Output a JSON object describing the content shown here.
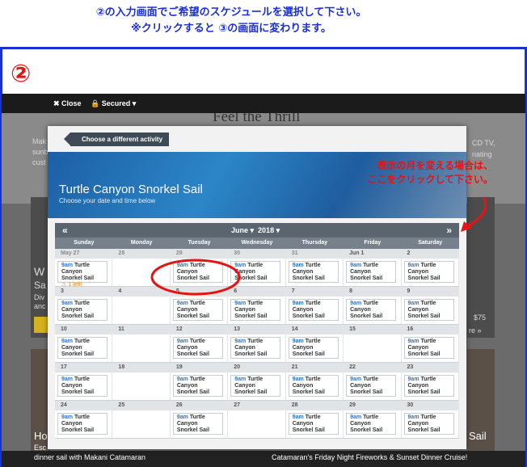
{
  "instructions": {
    "line1": "②の入力画面でご希望のスケジュールを選択して下さい。",
    "line2": "※クリックすると ③の画面に変わります。"
  },
  "step_number": "②",
  "topbar": {
    "close_label": "✖ Close",
    "secured_label": "🔒 Secured ▾"
  },
  "background": {
    "title": "Feel the Thrill",
    "left_snippets": [
      "Mak",
      "sunb",
      "cust"
    ],
    "right_snippets": [
      "CD TV,",
      "nating"
    ],
    "card_left": [
      "W",
      "Sa",
      "Div",
      "anc"
    ],
    "card_right": [
      "$75",
      "re »"
    ],
    "bottom_left_title": "Ho",
    "bottom_left_sub1": "Esc",
    "bottom_left_sub2": "dinner sail with Makani Catamaran",
    "bottom_right_title": "Sail",
    "bottom_right_sub": "Catamaran's Friday Night Fireworks & Sunset Dinner Cruise!"
  },
  "modal": {
    "back_label": "Choose a different activity",
    "title": "Turtle Canyon Snorkel Sail",
    "subtitle": "Choose your date and time below"
  },
  "calendar": {
    "prev_icon": "«",
    "next_icon": "»",
    "month": "June",
    "year": "2018",
    "weekdays": [
      "Sunday",
      "Monday",
      "Tuesday",
      "Wednesday",
      "Thursday",
      "Friday",
      "Saturday"
    ],
    "weeks": [
      [
        {
          "d": "May 27",
          "dim": true,
          "time": "9am",
          "name": "Turtle Canyon Snorkel Sail",
          "left": "⚠ 1 left!"
        },
        {
          "d": "28",
          "dim": true
        },
        {
          "d": "29",
          "dim": true,
          "time": "9am",
          "name": "Turtle Canyon Snorkel Sail"
        },
        {
          "d": "30",
          "dim": true,
          "time": "9am",
          "name": "Turtle Canyon Snorkel Sail"
        },
        {
          "d": "31",
          "dim": true,
          "time": "9am",
          "name": "Turtle Canyon Snorkel Sail"
        },
        {
          "d": "Jun 1",
          "time": "9am",
          "name": "Turtle Canyon Snorkel Sail"
        },
        {
          "d": "2",
          "time": "9am",
          "name": "Turtle Canyon Snorkel Sail"
        }
      ],
      [
        {
          "d": "3",
          "time": "9am",
          "name": "Turtle Canyon Snorkel Sail"
        },
        {
          "d": "4"
        },
        {
          "d": "5",
          "time": "9am",
          "name": "Turtle Canyon Snorkel Sail"
        },
        {
          "d": "6",
          "time": "9am",
          "name": "Turtle Canyon Snorkel Sail"
        },
        {
          "d": "7",
          "time": "9am",
          "name": "Turtle Canyon Snorkel Sail"
        },
        {
          "d": "8",
          "time": "9am",
          "name": "Turtle Canyon Snorkel Sail"
        },
        {
          "d": "9",
          "time": "9am",
          "name": "Turtle Canyon Snorkel Sail"
        }
      ],
      [
        {
          "d": "10",
          "time": "9am",
          "name": "Turtle Canyon Snorkel Sail"
        },
        {
          "d": "11"
        },
        {
          "d": "12",
          "time": "9am",
          "name": "Turtle Canyon Snorkel Sail"
        },
        {
          "d": "13",
          "time": "9am",
          "name": "Turtle Canyon Snorkel Sail"
        },
        {
          "d": "14",
          "time": "9am",
          "name": "Turtle Canyon Snorkel Sail"
        },
        {
          "d": "15"
        },
        {
          "d": "16",
          "time": "9am",
          "name": "Turtle Canyon Snorkel Sail"
        }
      ],
      [
        {
          "d": "17",
          "time": "9am",
          "name": "Turtle Canyon Snorkel Sail"
        },
        {
          "d": "18"
        },
        {
          "d": "19",
          "time": "9am",
          "name": "Turtle Canyon Snorkel Sail"
        },
        {
          "d": "20",
          "time": "9am",
          "name": "Turtle Canyon Snorkel Sail"
        },
        {
          "d": "21",
          "time": "9am",
          "name": "Turtle Canyon Snorkel Sail"
        },
        {
          "d": "22",
          "time": "9am",
          "name": "Turtle Canyon Snorkel Sail"
        },
        {
          "d": "23",
          "time": "9am",
          "name": "Turtle Canyon Snorkel Sail"
        }
      ],
      [
        {
          "d": "24",
          "time": "9am",
          "name": "Turtle Canyon Snorkel Sail"
        },
        {
          "d": "25"
        },
        {
          "d": "26",
          "time": "9am",
          "name": "Turtle Canyon Snorkel Sail"
        },
        {
          "d": "27"
        },
        {
          "d": "28",
          "time": "9am",
          "name": "Turtle Canyon Snorkel Sail"
        },
        {
          "d": "29",
          "time": "9am",
          "name": "Turtle Canyon Snorkel Sail"
        },
        {
          "d": "30",
          "time": "9am",
          "name": "Turtle Canyon Snorkel Sail"
        }
      ]
    ]
  },
  "annotation": {
    "line1": "表示の月を変える場合は、",
    "line2": "ここをクリックして下さい。"
  },
  "colors": {
    "annotation": "#e41414",
    "instruction": "#1a2fd6",
    "slot_time": "#2d76c2"
  }
}
